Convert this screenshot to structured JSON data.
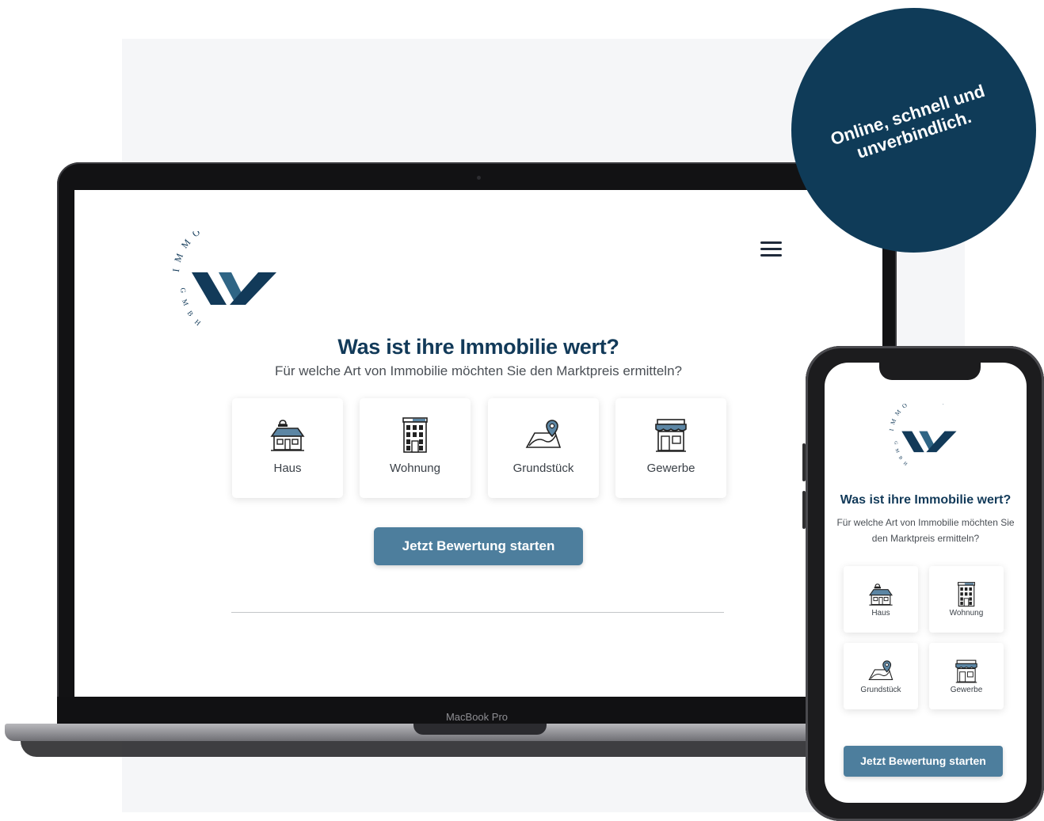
{
  "badge": {
    "line1": "Online, schnell und",
    "line2": "unverbindlich."
  },
  "laptop": {
    "brand": "MacBook Pro"
  },
  "brand": {
    "logo_ring_top": "IMMOVISTA",
    "logo_ring_left": "GMBH"
  },
  "valuation": {
    "title": "Was ist ihre Immobilie wert?",
    "subtitle": "Für welche Art von Immobilie möchten Sie den Marktpreis ermitteln?",
    "subtitle_mobile_line1": "Für welche Art von Immobilie möchten Sie",
    "subtitle_mobile_line2": "den Marktpreis ermitteln?",
    "property_types": [
      {
        "label": "Haus",
        "icon": "house-icon"
      },
      {
        "label": "Wohnung",
        "icon": "apartment-building-icon"
      },
      {
        "label": "Grundstück",
        "icon": "land-plot-icon"
      },
      {
        "label": "Gewerbe",
        "icon": "storefront-icon"
      }
    ],
    "cta_label": "Jetzt Bewertung starten"
  },
  "colors": {
    "accent": "#4d7e9d",
    "brand_dark": "#123a59",
    "badge": "#0f3b58"
  }
}
